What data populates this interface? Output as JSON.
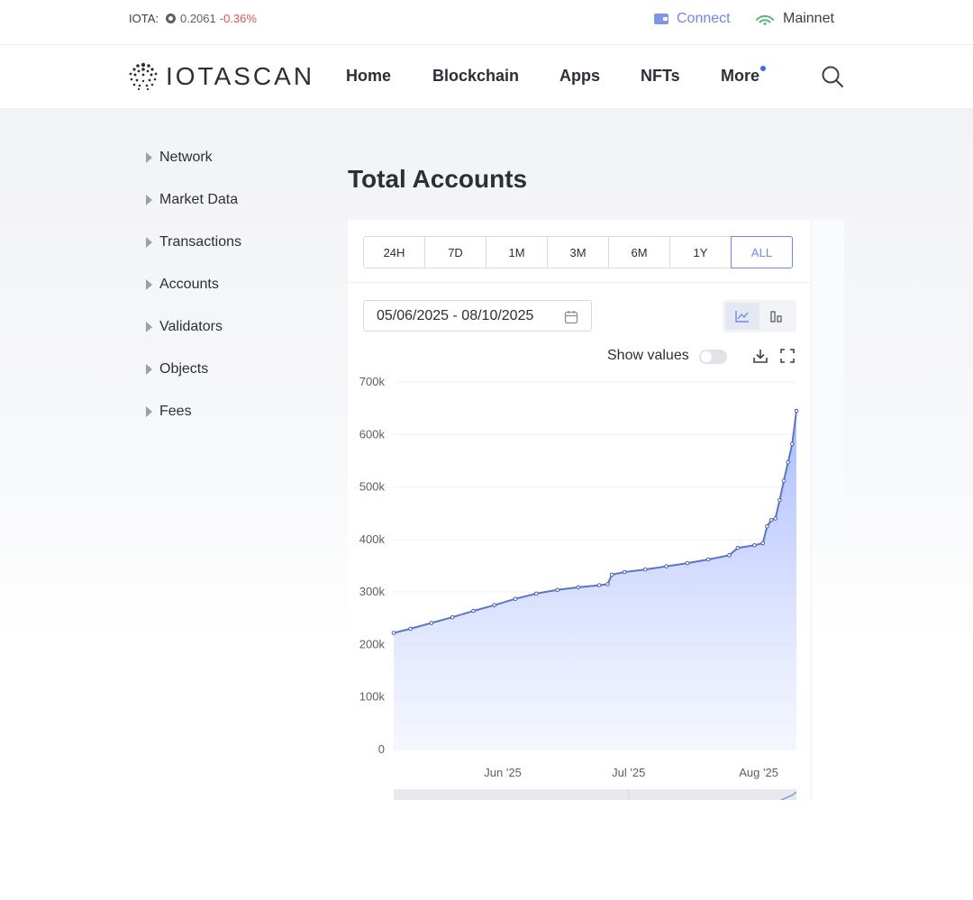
{
  "topbar": {
    "price_label": "IOTA:",
    "price_value": "0.2061",
    "price_change": "-0.36%",
    "connect_label": "Connect",
    "network_label": "Mainnet"
  },
  "nav": {
    "logo_text": "IOTASCAN",
    "items": [
      "Home",
      "Blockchain",
      "Apps",
      "NFTs",
      "More"
    ]
  },
  "sidebar": {
    "items": [
      "Network",
      "Market Data",
      "Transactions",
      "Accounts",
      "Validators",
      "Objects",
      "Fees"
    ]
  },
  "main": {
    "title": "Total Accounts",
    "ranges": [
      "24H",
      "7D",
      "1M",
      "3M",
      "6M",
      "1Y",
      "ALL"
    ],
    "active_range": "ALL",
    "date_range": "05/06/2025 - 08/10/2025",
    "show_values_label": "Show values",
    "show_values_on": false
  },
  "colors": {
    "accent": "#6f87e8",
    "line": "#5b76c9",
    "area_top": "#a5b8ff",
    "negative": "#e0564b",
    "network_ok": "#5fb37a"
  },
  "chart_data": {
    "type": "area",
    "title": "",
    "xlabel": "",
    "ylabel": "",
    "ylim": [
      0,
      700000
    ],
    "ytick_labels": [
      "0",
      "100k",
      "200k",
      "300k",
      "400k",
      "500k",
      "600k",
      "700k"
    ],
    "yticks": [
      0,
      100000,
      200000,
      300000,
      400000,
      500000,
      600000,
      700000
    ],
    "xtick_labels": [
      "Jun '25",
      "Jul '25",
      "Aug '25"
    ],
    "xticks": [
      "2025-06-01",
      "2025-07-01",
      "2025-08-01"
    ],
    "xlim": [
      "2025-05-06",
      "2025-08-10"
    ],
    "navigator_label": "Jul '25",
    "grid": true,
    "legend": "none",
    "series": [
      {
        "values": [
          [
            "2025-05-06",
            222000
          ],
          [
            "2025-05-10",
            230000
          ],
          [
            "2025-05-15",
            241000
          ],
          [
            "2025-05-20",
            252000
          ],
          [
            "2025-05-25",
            264000
          ],
          [
            "2025-05-30",
            275000
          ],
          [
            "2025-06-04",
            287000
          ],
          [
            "2025-06-09",
            297000
          ],
          [
            "2025-06-14",
            304000
          ],
          [
            "2025-06-19",
            309000
          ],
          [
            "2025-06-24",
            313000
          ],
          [
            "2025-06-26",
            315000
          ],
          [
            "2025-06-27",
            333000
          ],
          [
            "2025-06-30",
            338000
          ],
          [
            "2025-07-05",
            343000
          ],
          [
            "2025-07-10",
            349000
          ],
          [
            "2025-07-15",
            355000
          ],
          [
            "2025-07-20",
            362000
          ],
          [
            "2025-07-25",
            370000
          ],
          [
            "2025-07-27",
            384000
          ],
          [
            "2025-07-31",
            389000
          ],
          [
            "2025-08-02",
            393000
          ],
          [
            "2025-08-03",
            425000
          ],
          [
            "2025-08-04",
            437000
          ],
          [
            "2025-08-05",
            440000
          ],
          [
            "2025-08-06",
            475000
          ],
          [
            "2025-08-07",
            512000
          ],
          [
            "2025-08-08",
            547000
          ],
          [
            "2025-08-09",
            582000
          ],
          [
            "2025-08-10",
            645000
          ]
        ]
      }
    ]
  }
}
